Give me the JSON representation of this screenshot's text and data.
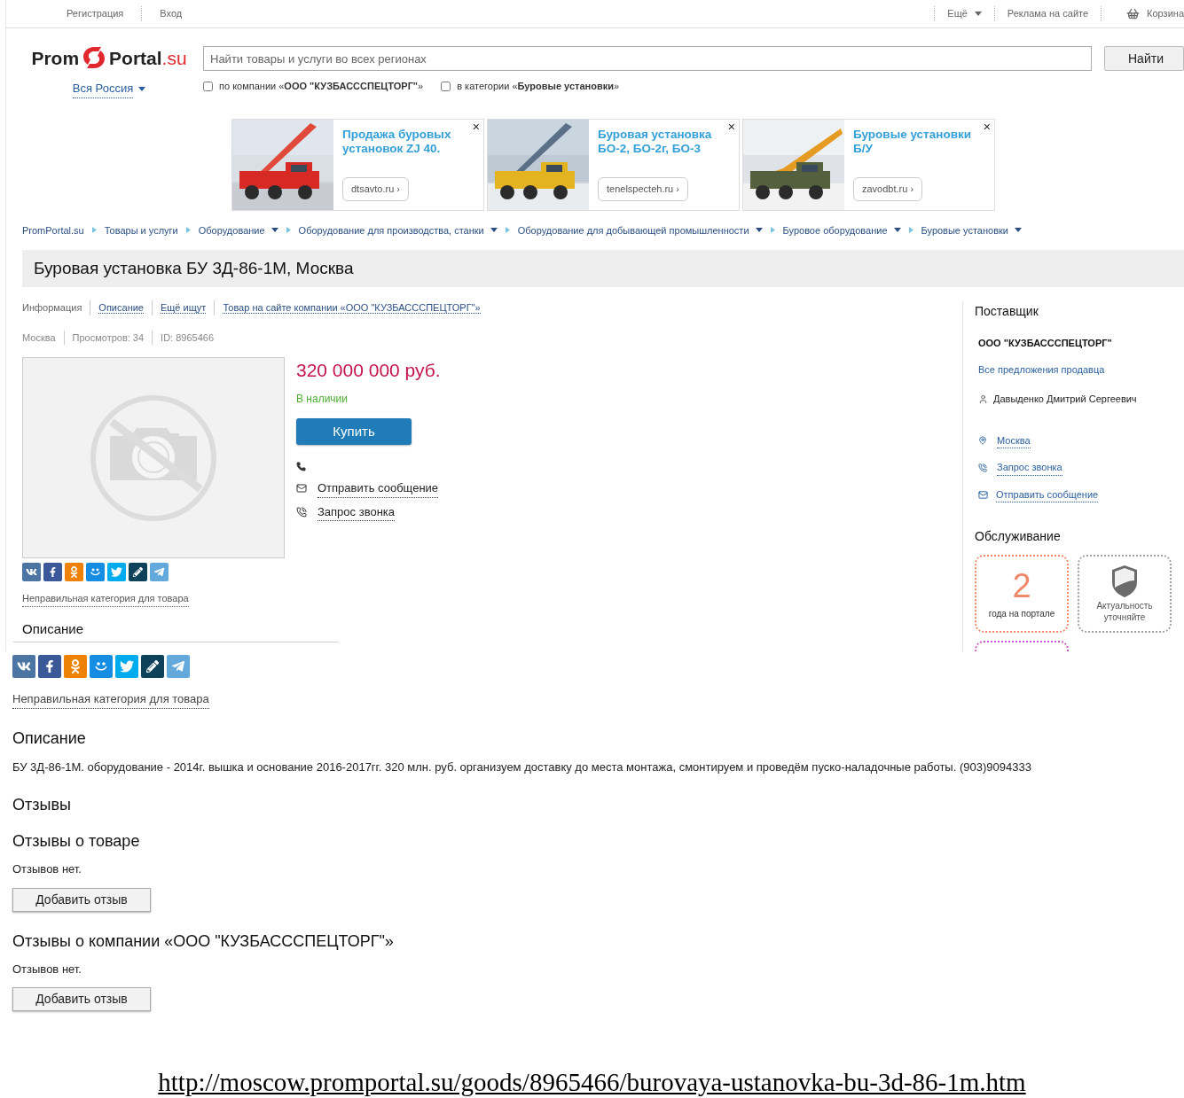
{
  "top_bar": {
    "left_links": [
      "Регистрация",
      "Вход"
    ],
    "more": "Ещё",
    "ads_link": "Реклама на сайте",
    "cart": "Корзина"
  },
  "header": {
    "logo": {
      "part_1": "Prom",
      "part_2": "Portal",
      "part_3": ".su"
    },
    "region": "Вся Россия",
    "search": {
      "placeholder": "Найти товары и услуги во всех регионах"
    },
    "search_button": "Найти",
    "filters": [
      {
        "label": "по компании «**ООО \"КУЗБАССCПЕЦТОРГ\"**»",
        "checked": false
      },
      {
        "label": "в категории «**Буровые установки**»",
        "checked": false
      }
    ]
  },
  "ads": [
    {
      "title": "Продажа буровых установок ZJ 40.",
      "domain": "dtsavto.ru ›",
      "close": "×"
    },
    {
      "title": "Буровая установка БО-2, БО-2г, БО-3",
      "domain": "tenelspecteh.ru ›",
      "close": "×"
    },
    {
      "title": "Буровые установки Б/У",
      "domain": "zavodbt.ru ›",
      "close": "×"
    }
  ],
  "breadcrumbs": [
    {
      "label": "PromPortal.su",
      "dropdown": false
    },
    {
      "label": "Товары и услуги",
      "dropdown": false
    },
    {
      "label": "Оборудование",
      "dropdown": true
    },
    {
      "label": "Оборудование для производства, станки",
      "dropdown": true
    },
    {
      "label": "Оборудование для добывающей промышленности",
      "dropdown": true
    },
    {
      "label": "Буровое оборудование",
      "dropdown": true
    },
    {
      "label": "Буровые установки",
      "dropdown": true
    }
  ],
  "product": {
    "title": "Буровая установка БУ 3Д-86-1М, Москва",
    "tabs": [
      {
        "label": "Информация",
        "selected": true
      },
      {
        "label": "Описание",
        "selected": false
      },
      {
        "label": "Ещё ищут",
        "selected": false
      },
      {
        "label": "Товар на сайте компании «ООО \"КУЗБАССCПЕЦТОРГ\"»",
        "selected": false
      }
    ],
    "meta": [
      "Москва",
      "Просмотров: 34",
      "ID: 8965466"
    ],
    "price": "320 000 000 руб.",
    "availability": "В наличии",
    "buy_button": "Купить",
    "message_link": "Отправить сообщение",
    "call_link": "Запрос звонка",
    "wrong_category": "Неправильная категория для товара",
    "description_heading": "Описание"
  },
  "supplier": {
    "heading": "Поставщик",
    "company": "ООО \"КУЗБАССCПЕЦТОРГ\"",
    "all_offers": "Все предложения продавца",
    "person": "Давыденко Дмитрий Сергеевич",
    "city": "Москва",
    "call_request": "Запрос звонка",
    "message": "Отправить сообщение",
    "service_heading": "Обслуживание",
    "badges": [
      {
        "kind": "years",
        "value": "2",
        "caption": "года на портале",
        "color": "#f0896a"
      },
      {
        "kind": "shield",
        "caption": "Актуальность уточняйте",
        "color": "#a0a0a0"
      },
      {
        "kind": "blank",
        "color": "#c25bc2"
      }
    ]
  },
  "print_view": {
    "wrong_category": "Неправильная категория для товара",
    "description_heading": "Описание",
    "description": "БУ 3Д-86-1М. оборудование - 2014г. вышка и основание 2016-2017гг. 320 млн. руб. организуем доставку до места монтажа, смонтируем и проведём пуско-наладочные работы. (903)9094333",
    "reviews_heading": "Отзывы",
    "review_sections": [
      {
        "heading": "Отзывы о товаре",
        "empty": "Отзывов нет.",
        "button": "Добавить отзыв"
      },
      {
        "heading": "Отзывы о компании «ООО \"КУЗБАССCПЕЦТОРГ\"»",
        "empty": "Отзывов нет.",
        "button": "Добавить отзыв"
      }
    ]
  },
  "url": "http://moscow.promportal.su/goods/8965466/burovaya-ustanovka-bu-3d-86-1m.htm"
}
